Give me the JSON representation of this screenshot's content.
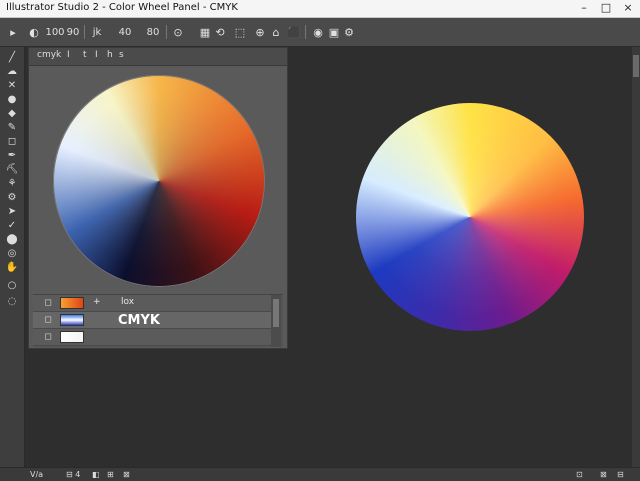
{
  "window": {
    "title": "Illustrator Studio 2 - Color Wheel Panel - CMYK",
    "controls": [
      "–",
      "□",
      "×"
    ]
  },
  "toolbar": {
    "items": [
      {
        "name": "tool-1-icon",
        "text": "▸"
      },
      {
        "name": "tool-2-icon",
        "text": "◐"
      },
      {
        "name": "zoom-100",
        "text": "100"
      },
      {
        "name": "zoom-90",
        "text": "90"
      },
      {
        "name": "label-jk",
        "text": "jk"
      },
      {
        "name": "label-40",
        "text": "40"
      },
      {
        "name": "label-80",
        "text": "80"
      },
      {
        "name": "tool-3-icon",
        "text": "⊙"
      },
      {
        "name": "tool-4-icon",
        "text": "▦"
      },
      {
        "name": "tool-5-icon",
        "text": "⟲"
      },
      {
        "name": "tool-6-icon",
        "text": "⬚"
      },
      {
        "name": "tool-7-icon",
        "text": "⊕"
      },
      {
        "name": "tool-8-icon",
        "text": "⌂"
      },
      {
        "name": "tool-9-icon",
        "text": "⬛"
      },
      {
        "name": "tool-10-icon",
        "text": "◉"
      },
      {
        "name": "tool-11-icon",
        "text": "▣"
      },
      {
        "name": "tool-12-icon",
        "text": "⚙"
      }
    ]
  },
  "tools": [
    {
      "name": "line-tool-icon",
      "glyph": "╱"
    },
    {
      "name": "cloud-tool-icon",
      "glyph": "☁"
    },
    {
      "name": "cross-tool-icon",
      "glyph": "✕"
    },
    {
      "name": "circle-tool-icon",
      "glyph": "●"
    },
    {
      "name": "gem-tool-icon",
      "glyph": "◆"
    },
    {
      "name": "brush-tool-icon",
      "glyph": "✎"
    },
    {
      "name": "shape-tool-icon",
      "glyph": "◻"
    },
    {
      "name": "pen-tool-icon",
      "glyph": "✒"
    },
    {
      "name": "bucket-tool-icon",
      "glyph": "⛏"
    },
    {
      "name": "flame-tool-icon",
      "glyph": "⚘"
    },
    {
      "name": "gear-tool-icon",
      "glyph": "⚙"
    },
    {
      "name": "pointer-tool-icon",
      "glyph": "➤"
    },
    {
      "name": "check-tool-icon",
      "glyph": "✓"
    },
    {
      "name": "drop-tool-icon",
      "glyph": "⬤"
    },
    {
      "name": "eye-tool-icon",
      "glyph": "◎"
    },
    {
      "name": "hand-tool-icon",
      "glyph": "✋"
    },
    {
      "name": "white-dot-tool-icon",
      "glyph": "○"
    },
    {
      "name": "blob-tool-icon",
      "glyph": "◌"
    }
  ],
  "panel": {
    "tabs": [
      "cmyk",
      "I",
      "t",
      "I",
      "h",
      "s"
    ],
    "layers": [
      {
        "name": "layer-1",
        "swatch_gradient": "linear-gradient(90deg,#f6a030,#e04418)",
        "text1": "+",
        "text2": "lox",
        "label": ""
      },
      {
        "name": "layer-2",
        "swatch_gradient": "linear-gradient(180deg,#3f7be8,#fefefe,#2a3ec4)",
        "text1": "",
        "text2": "",
        "label": "CMYK"
      },
      {
        "name": "layer-3",
        "swatch_gradient": "linear-gradient(90deg,#ffffff,#f4f4f4)",
        "text1": "",
        "text2": "",
        "label": ""
      }
    ]
  },
  "statusbar": {
    "items": [
      "V/a",
      "⊟ 4",
      "◧",
      "⊞",
      "⊠"
    ],
    "right_items": [
      "⊡",
      "⊠",
      "⊟"
    ]
  },
  "colors": {
    "panel_bg": "#5a5a5a",
    "toolbar_bg": "#4a4a4a",
    "workspace_bg": "#2e2e2e"
  }
}
